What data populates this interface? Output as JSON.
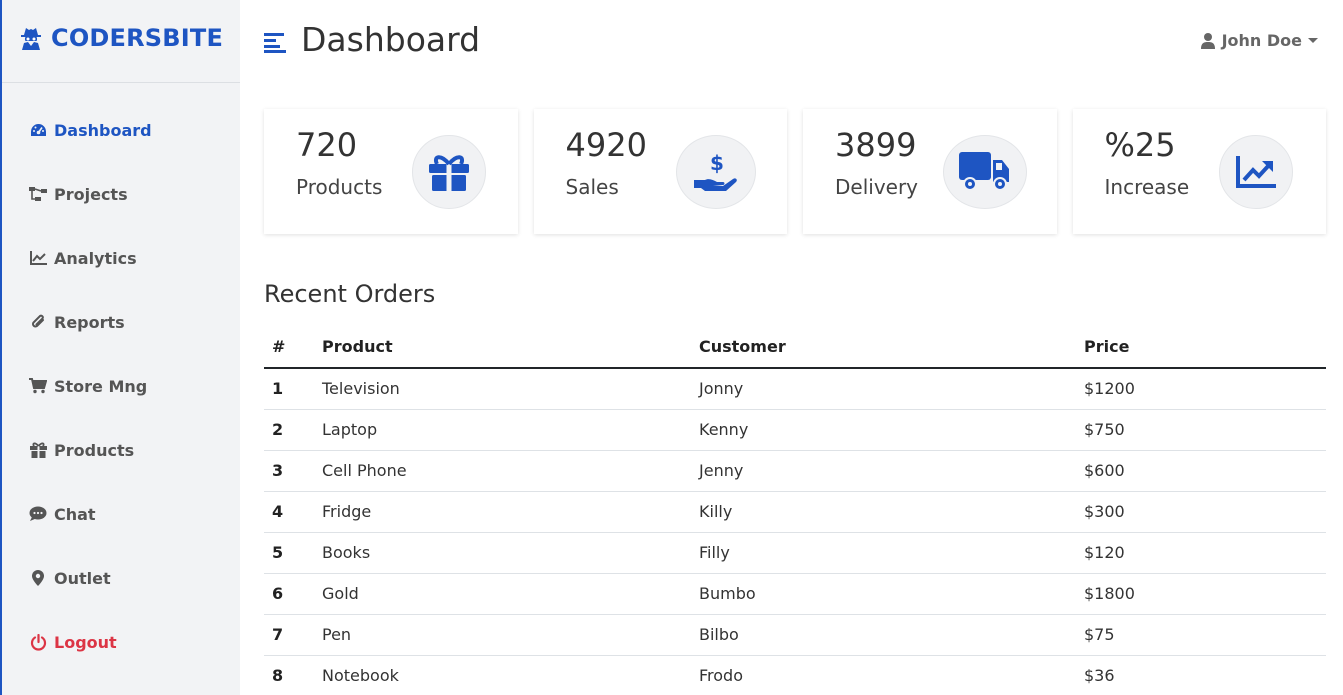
{
  "brand": {
    "name": "CODERSBITE"
  },
  "colors": {
    "accent": "#1e55c2",
    "danger": "#dc3545",
    "sidebar_bg": "#f2f3f5"
  },
  "sidebar": {
    "items": [
      {
        "label": "Dashboard",
        "icon": "gauge-icon"
      },
      {
        "label": "Projects",
        "icon": "sitemap-icon"
      },
      {
        "label": "Analytics",
        "icon": "chart-line-icon"
      },
      {
        "label": "Reports",
        "icon": "paperclip-icon"
      },
      {
        "label": "Store Mng",
        "icon": "cart-icon"
      },
      {
        "label": "Products",
        "icon": "gift-icon"
      },
      {
        "label": "Chat",
        "icon": "comment-icon"
      },
      {
        "label": "Outlet",
        "icon": "map-marker-icon"
      },
      {
        "label": "Logout",
        "icon": "power-icon"
      }
    ]
  },
  "header": {
    "title": "Dashboard",
    "user": "John Doe"
  },
  "cards": [
    {
      "value": "720",
      "label": "Products",
      "icon": "gift-icon"
    },
    {
      "value": "4920",
      "label": "Sales",
      "icon": "hand-dollar-icon"
    },
    {
      "value": "3899",
      "label": "Delivery",
      "icon": "truck-icon"
    },
    {
      "value": "%25",
      "label": "Increase",
      "icon": "chart-increase-icon"
    }
  ],
  "orders": {
    "title": "Recent Orders",
    "headers": [
      "#",
      "Product",
      "Customer",
      "Price"
    ],
    "rows": [
      [
        "1",
        "Television",
        "Jonny",
        "$1200"
      ],
      [
        "2",
        "Laptop",
        "Kenny",
        "$750"
      ],
      [
        "3",
        "Cell Phone",
        "Jenny",
        "$600"
      ],
      [
        "4",
        "Fridge",
        "Killy",
        "$300"
      ],
      [
        "5",
        "Books",
        "Filly",
        "$120"
      ],
      [
        "6",
        "Gold",
        "Bumbo",
        "$1800"
      ],
      [
        "7",
        "Pen",
        "Bilbo",
        "$75"
      ],
      [
        "8",
        "Notebook",
        "Frodo",
        "$36"
      ]
    ]
  }
}
